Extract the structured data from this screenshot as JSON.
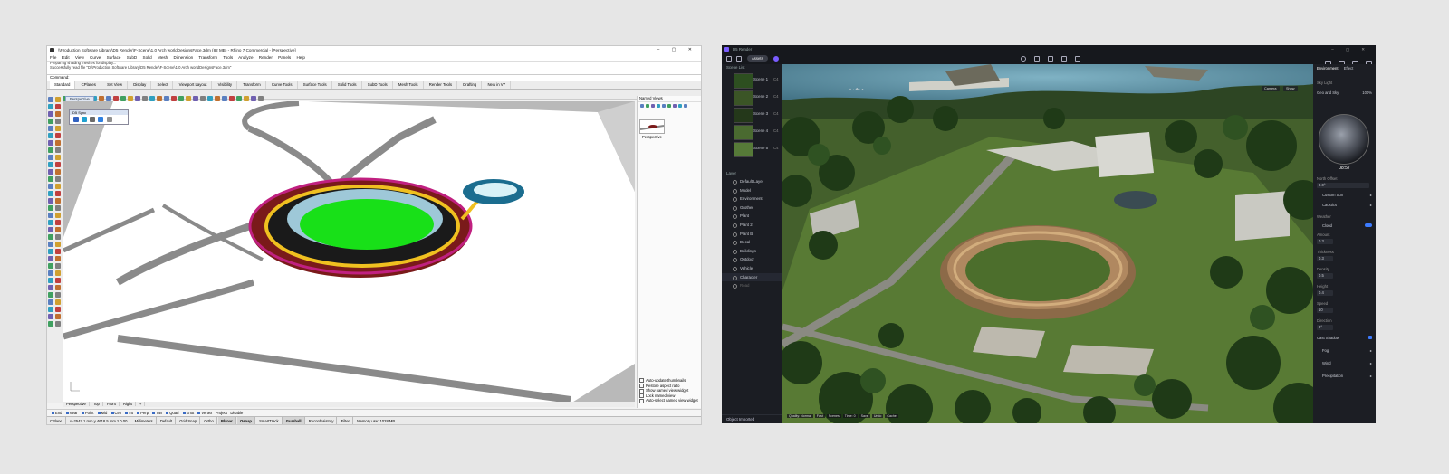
{
  "rhino": {
    "title": "\\\\Production Software Library\\D5 Render\\F-Scene\\1.0 Arch worldDesignsFace.3dm (82 MB) - Rhino 7 Commercial - [Perspective]",
    "menus": [
      "File",
      "Edit",
      "View",
      "Curve",
      "Surface",
      "SubD",
      "Solid",
      "Mesh",
      "Dimension",
      "Transform",
      "Tools",
      "Analyze",
      "Render",
      "Panels",
      "Help"
    ],
    "command_history": [
      "Preparing shading meshes for display...",
      "Successfully read file \"D:\\Production Software Library\\D5 Render\\F-Scene\\1.0 Arch worldDesignsFace.3dm\""
    ],
    "command_label": "Command:",
    "tabs": [
      "Standard",
      "CPlanes",
      "Set View",
      "Display",
      "Select",
      "Viewport Layout",
      "Visibility",
      "Transform",
      "Curve Tools",
      "Surface Tools",
      "Solid Tools",
      "SubD Tools",
      "Mesh Tools",
      "Render Tools",
      "Drafting",
      "New in V7"
    ],
    "viewport_tab": "Perspective",
    "sync_box_title": "D5 Sync",
    "named_views_title": "Named Views",
    "named_view_item": "Perspective",
    "panel_options": [
      "Auto-update thumbnails",
      "Restore aspect ratio",
      "Show named view widget",
      "Lock named view",
      "Auto-select named view widget"
    ],
    "viewport_tabs": [
      "Perspective",
      "Top",
      "Front",
      "Right",
      "+"
    ],
    "osnaps": [
      "End",
      "Near",
      "Point",
      "Mid",
      "Cen",
      "Int",
      "Perp",
      "Tan",
      "Quad",
      "Knot",
      "Vertex"
    ],
    "osnap_extra": [
      "Project",
      "Disable"
    ],
    "status": {
      "cplane": "CPlane",
      "coords": "x -2547.1 mm  y 4618.5 mm  z 0.00",
      "units": "Millimeters",
      "layer": "Default",
      "toggles": [
        "Grid Snap",
        "Ortho",
        "Planar",
        "Osnap",
        "SmartTrack",
        "Gumball",
        "Record History",
        "Filter"
      ],
      "active_toggles": [
        "Planar",
        "Osnap",
        "Gumball"
      ],
      "memory": "Memory use: 1028 MB"
    }
  },
  "d5": {
    "app_title": "D5 Render",
    "mode_label": "Assets",
    "scene_list_title": "Scene List",
    "scenes": [
      {
        "name": "Scene 1",
        "count": "C4"
      },
      {
        "name": "Scene 2",
        "count": "C4"
      },
      {
        "name": "Scene 3",
        "count": "C4"
      },
      {
        "name": "Scene 4",
        "count": "C4"
      },
      {
        "name": "Scene 5",
        "count": "C4"
      }
    ],
    "layer_title": "Layer",
    "layers": [
      "Default Layer",
      "Model",
      "Environment",
      "Grother",
      "Plant",
      "Plant 2",
      "Plant B",
      "Decal",
      "Buildings",
      "Outdoor",
      "Vehicle",
      "Character",
      "Road"
    ],
    "bottom_tabs": "Object   Imported",
    "right_tabs": [
      "Environment",
      "Effect"
    ],
    "sky_type_label": "Sky Light",
    "sky_value": "Geo and Sky",
    "sky_intensity": "100%",
    "time": "08:57",
    "north_offset_label": "North Offset",
    "north_offset_value": "0.0°",
    "custom_sun": "Custom Sun",
    "caustics": "Caustics",
    "weather_label": "Weather",
    "cloud_label": "Cloud",
    "cloud_params": [
      {
        "label": "Amount",
        "value": "0.3"
      },
      {
        "label": "Thickness",
        "value": "0.3"
      },
      {
        "label": "Density",
        "value": "0.5"
      },
      {
        "label": "Height",
        "value": "0.4"
      },
      {
        "label": "Speed",
        "value": "10"
      },
      {
        "label": "Direction",
        "value": "0°"
      }
    ],
    "cast_shadow": "Cast Shadow",
    "fog": "Fog",
    "wind": "Wind",
    "precipitation": "Precipitation",
    "viewport_buttons": [
      "Camera",
      "Show"
    ],
    "bottom_status": [
      "Quality: Normal",
      "Fast",
      "Scenes",
      "Time: 0",
      "Save",
      "Undo",
      "Cache"
    ]
  },
  "colors": {
    "rhino_bg": "#f2f2f2",
    "d5_bg": "#16181d",
    "d5_accent": "#3c7bff",
    "stadium_field": "#18e018",
    "stadium_ring": "#f0c020"
  }
}
